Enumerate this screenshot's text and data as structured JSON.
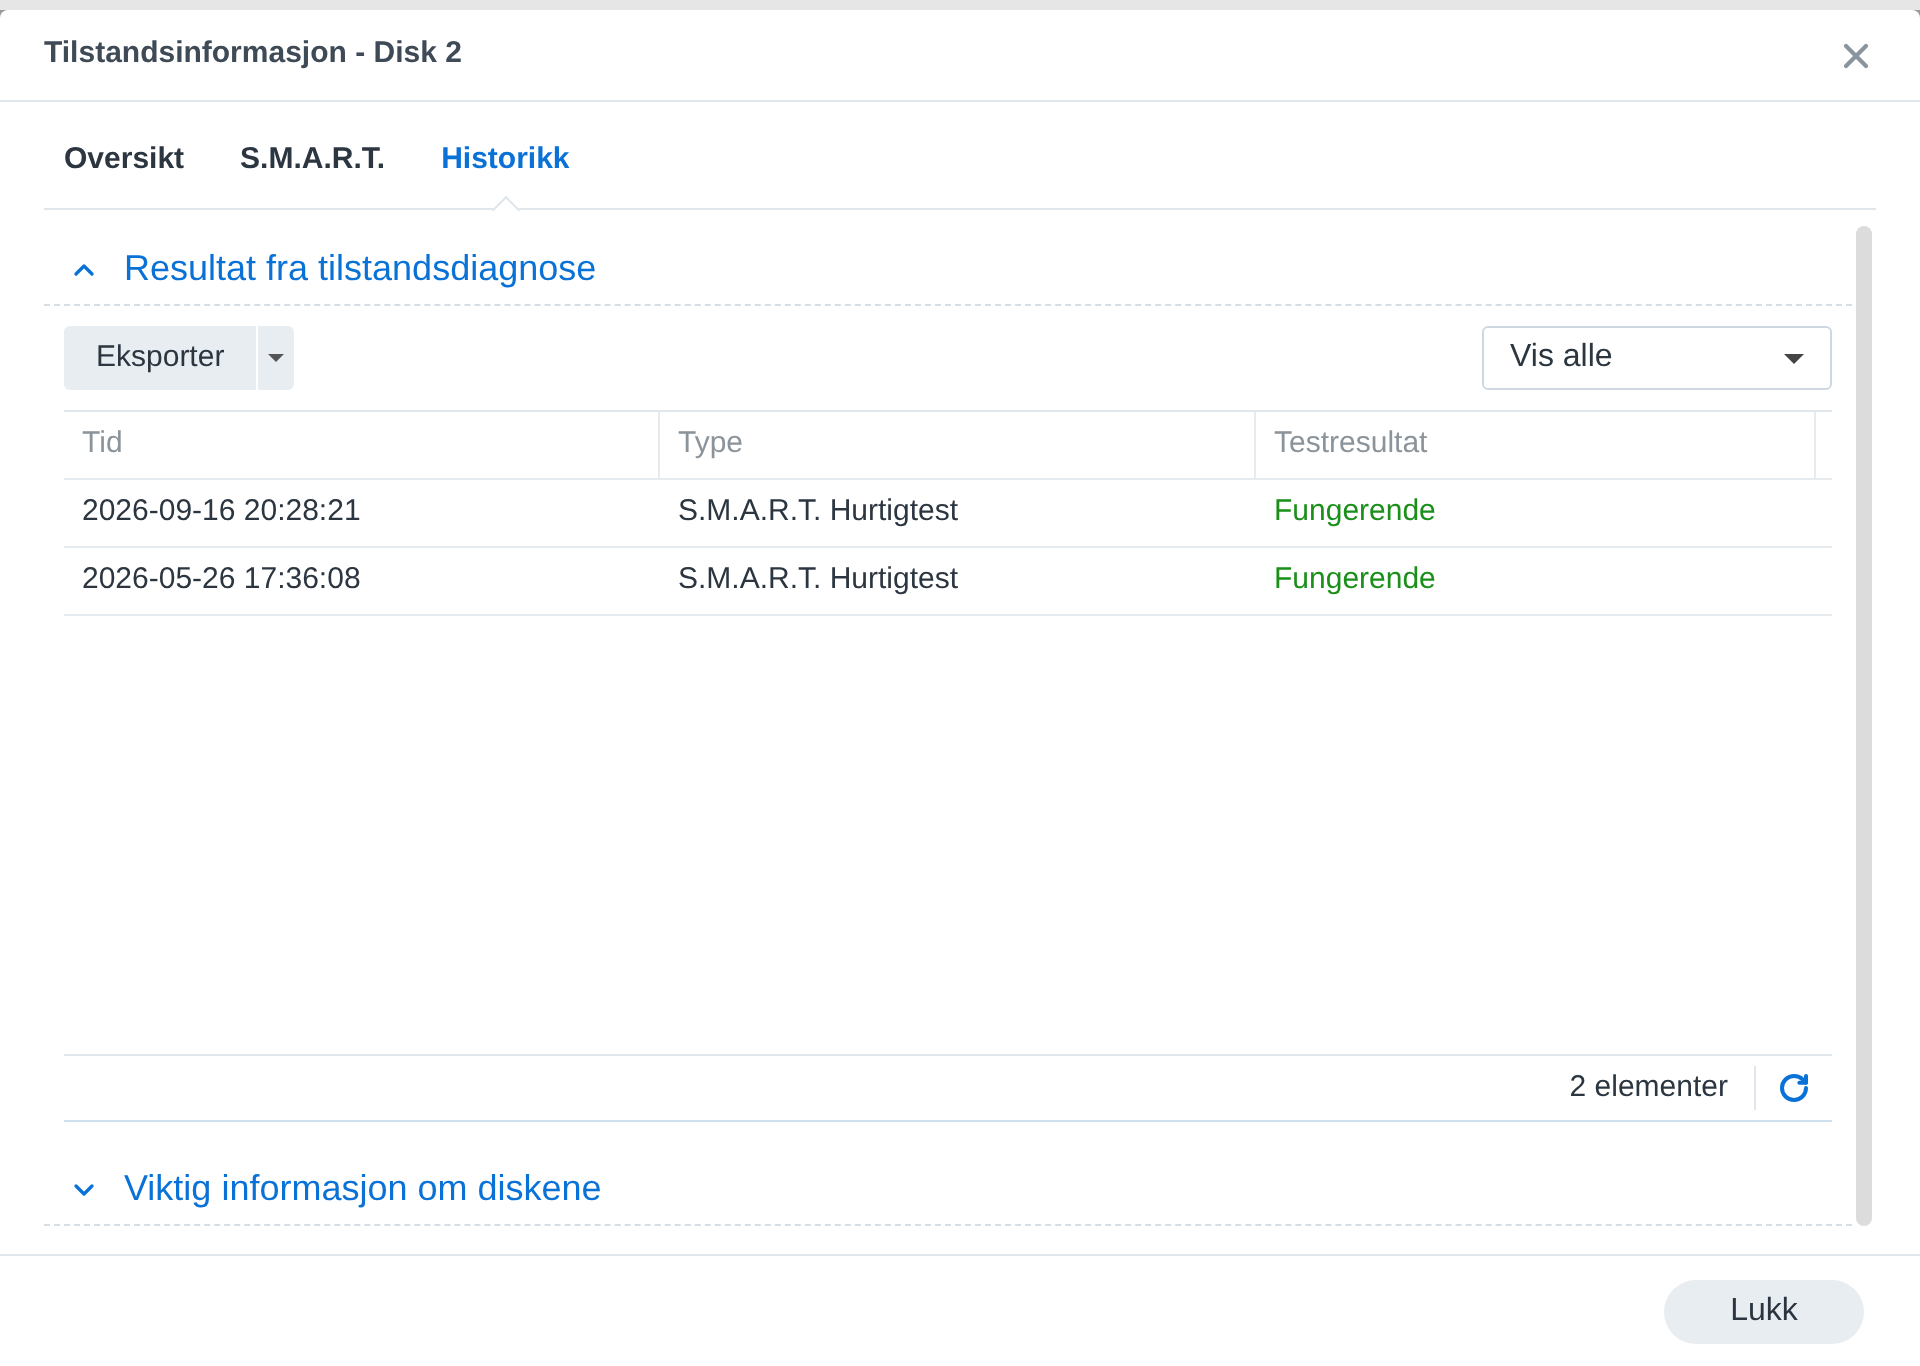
{
  "window": {
    "title": "Tilstandsinformasjon - Disk 2"
  },
  "tabs": [
    {
      "label": "Oversikt",
      "selected": false
    },
    {
      "label": "S.M.A.R.T.",
      "selected": false
    },
    {
      "label": "Historikk",
      "selected": true
    }
  ],
  "sections": [
    {
      "title": "Resultat fra tilstandsdiagnose",
      "expanded": true
    },
    {
      "title": "Viktig informasjon om diskene",
      "expanded": false
    }
  ],
  "toolbar": {
    "export_button": "Eksporter",
    "filter": "Vis alle"
  },
  "table": {
    "columns": [
      "Tid",
      "Type",
      "Testresultat"
    ],
    "rows": [
      {
        "cells": [
          "2026-09-16 20:28:21",
          "S.M.A.R.T. Hurtigtest",
          "Fungerende"
        ],
        "kind": "ok"
      },
      {
        "cells": [
          "2026-05-26 17:36:08",
          "S.M.A.R.T. Hurtigtest",
          "Fungerende"
        ],
        "kind": "ok"
      }
    ],
    "count": "2 elementer"
  },
  "buttons": [
    "Lukk"
  ]
}
